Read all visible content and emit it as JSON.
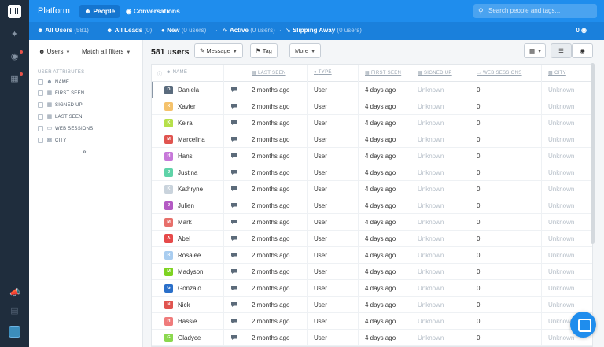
{
  "app": {
    "title": "Platform",
    "tabs": [
      {
        "label": "People",
        "icon": "people-icon",
        "active": true
      },
      {
        "label": "Conversations",
        "icon": "chat-bubble-icon",
        "active": false
      }
    ],
    "search_placeholder": "Search people and tags..."
  },
  "segments": [
    {
      "label": "All Users",
      "count": "(581)",
      "icon": "people-icon",
      "active": true
    },
    {
      "label": "All Leads",
      "count": "(0)",
      "icon": "people-icon",
      "active": false
    },
    {
      "label": "New",
      "count": "(0 users)",
      "icon": "person-icon",
      "active": false
    },
    {
      "label": "Active",
      "count": "(0 users)",
      "icon": "pulse-icon",
      "active": false
    },
    {
      "label": "Slipping Away",
      "count": "(0 users)",
      "icon": "trend-down-icon",
      "active": false
    }
  ],
  "viewers": {
    "count": "0",
    "icon": "eye-icon"
  },
  "filters": {
    "users_dropdown": "Users",
    "match_dropdown": "Match all filters",
    "attributes_header": "USER ATTRIBUTES",
    "attributes": [
      {
        "label": "NAME",
        "icon": "people-icon"
      },
      {
        "label": "FIRST SEEN",
        "icon": "calendar-icon"
      },
      {
        "label": "SIGNED UP",
        "icon": "calendar-icon"
      },
      {
        "label": "LAST SEEN",
        "icon": "calendar-icon"
      },
      {
        "label": "WEB SESSIONS",
        "icon": "browser-icon"
      },
      {
        "label": "CITY",
        "icon": "building-icon"
      }
    ],
    "more_icon": "double-chevron-down-icon"
  },
  "toolbar": {
    "count_label": "581 users",
    "message_label": "Message",
    "tag_label": "Tag",
    "more_label": "More"
  },
  "table": {
    "columns": [
      "NAME",
      "LAST SEEN",
      "TYPE",
      "FIRST SEEN",
      "SIGNED UP",
      "WEB SESSIONS",
      "CITY"
    ],
    "rows": [
      {
        "initial": "D",
        "name": "Daniela",
        "color": "#5a6b7d",
        "last_seen": "2 months ago",
        "type": "User",
        "first_seen": "4 days ago",
        "signed_up": "Unknown",
        "sessions": "0",
        "city": "Unknown"
      },
      {
        "initial": "X",
        "name": "Xavier",
        "color": "#f5c26b",
        "last_seen": "2 months ago",
        "type": "User",
        "first_seen": "4 days ago",
        "signed_up": "Unknown",
        "sessions": "0",
        "city": "Unknown"
      },
      {
        "initial": "K",
        "name": "Keira",
        "color": "#b6e04a",
        "last_seen": "2 months ago",
        "type": "User",
        "first_seen": "4 days ago",
        "signed_up": "Unknown",
        "sessions": "0",
        "city": "Unknown"
      },
      {
        "initial": "M",
        "name": "Marcelina",
        "color": "#e0544f",
        "last_seen": "2 months ago",
        "type": "User",
        "first_seen": "4 days ago",
        "signed_up": "Unknown",
        "sessions": "0",
        "city": "Unknown"
      },
      {
        "initial": "H",
        "name": "Hans",
        "color": "#c778d9",
        "last_seen": "2 months ago",
        "type": "User",
        "first_seen": "4 days ago",
        "signed_up": "Unknown",
        "sessions": "0",
        "city": "Unknown"
      },
      {
        "initial": "J",
        "name": "Justina",
        "color": "#5fd3a8",
        "last_seen": "2 months ago",
        "type": "User",
        "first_seen": "4 days ago",
        "signed_up": "Unknown",
        "sessions": "0",
        "city": "Unknown"
      },
      {
        "initial": "K",
        "name": "Kathryne",
        "color": "#c9d3dc",
        "last_seen": "2 months ago",
        "type": "User",
        "first_seen": "4 days ago",
        "signed_up": "Unknown",
        "sessions": "0",
        "city": "Unknown"
      },
      {
        "initial": "J",
        "name": "Julien",
        "color": "#b45ac4",
        "last_seen": "2 months ago",
        "type": "User",
        "first_seen": "4 days ago",
        "signed_up": "Unknown",
        "sessions": "0",
        "city": "Unknown"
      },
      {
        "initial": "M",
        "name": "Mark",
        "color": "#e76f6a",
        "last_seen": "2 months ago",
        "type": "User",
        "first_seen": "4 days ago",
        "signed_up": "Unknown",
        "sessions": "0",
        "city": "Unknown"
      },
      {
        "initial": "A",
        "name": "Abel",
        "color": "#e64a4a",
        "last_seen": "2 months ago",
        "type": "User",
        "first_seen": "4 days ago",
        "signed_up": "Unknown",
        "sessions": "0",
        "city": "Unknown"
      },
      {
        "initial": "R",
        "name": "Rosalee",
        "color": "#a9cdf0",
        "last_seen": "2 months ago",
        "type": "User",
        "first_seen": "4 days ago",
        "signed_up": "Unknown",
        "sessions": "0",
        "city": "Unknown"
      },
      {
        "initial": "M",
        "name": "Madyson",
        "color": "#7ed321",
        "last_seen": "2 months ago",
        "type": "User",
        "first_seen": "4 days ago",
        "signed_up": "Unknown",
        "sessions": "0",
        "city": "Unknown"
      },
      {
        "initial": "G",
        "name": "Gonzalo",
        "color": "#2a6fc9",
        "last_seen": "2 months ago",
        "type": "User",
        "first_seen": "4 days ago",
        "signed_up": "Unknown",
        "sessions": "0",
        "city": "Unknown"
      },
      {
        "initial": "N",
        "name": "Nick",
        "color": "#e0544f",
        "last_seen": "2 months ago",
        "type": "User",
        "first_seen": "4 days ago",
        "signed_up": "Unknown",
        "sessions": "0",
        "city": "Unknown"
      },
      {
        "initial": "H",
        "name": "Hassie",
        "color": "#ef7b7b",
        "last_seen": "2 months ago",
        "type": "User",
        "first_seen": "4 days ago",
        "signed_up": "Unknown",
        "sessions": "0",
        "city": "Unknown"
      },
      {
        "initial": "G",
        "name": "Gladyce",
        "color": "#8bd84e",
        "last_seen": "2 months ago",
        "type": "User",
        "first_seen": "4 days ago",
        "signed_up": "Unknown",
        "sessions": "0",
        "city": "Unknown"
      }
    ]
  },
  "colors": {
    "brand": "#1f8ded",
    "rail": "#1f2d3d"
  }
}
